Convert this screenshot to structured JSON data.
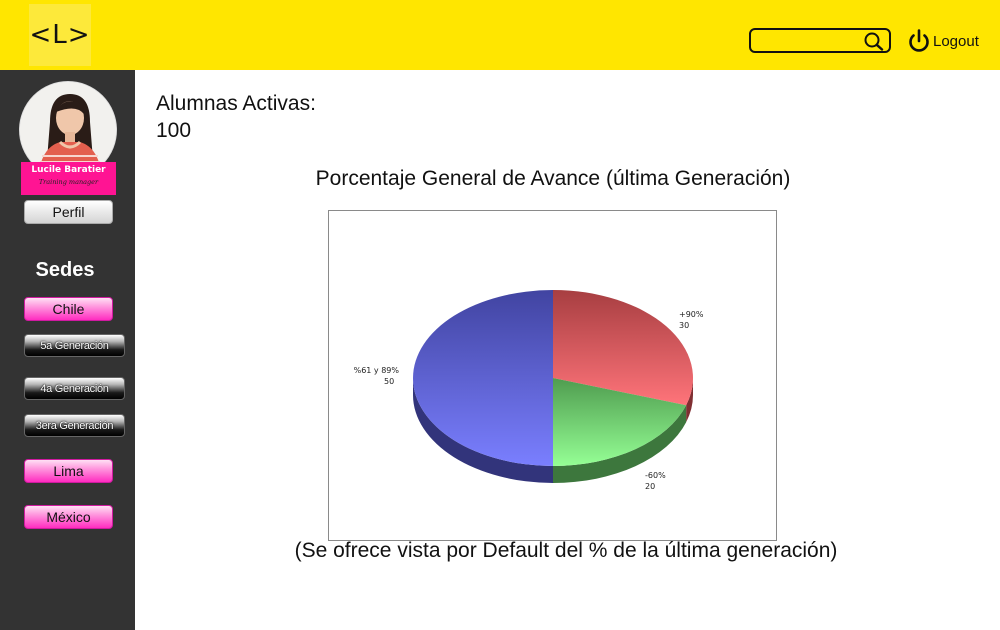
{
  "header": {
    "logo_text": "<L>",
    "search": {
      "value": "",
      "placeholder": "",
      "icon": "search-icon"
    },
    "logout_label": "Logout",
    "logout_icon": "power-icon",
    "accent_color": "#ffe600"
  },
  "sidebar": {
    "profile": {
      "name": "Lucile Baratier",
      "role": "Training manager"
    },
    "perfil_label": "Perfil",
    "sedes_heading": "Sedes",
    "sedes": [
      {
        "label": "Chile",
        "generations": [
          "5a Generación",
          "4a Generación",
          "3era Generación"
        ]
      },
      {
        "label": "Lima"
      },
      {
        "label": "México"
      }
    ],
    "accent_color": "#ff1493",
    "background": "#333333"
  },
  "main": {
    "active_label": "Alumnas Activas:",
    "active_value": "100",
    "chart_title": "Porcentaje General de Avance (última Generación)",
    "footer_note": "(Se ofrece vista por Default del % de la última generación)"
  },
  "chart_data": {
    "type": "pie",
    "title": "",
    "slices": [
      {
        "label": "+90%",
        "value": 30,
        "color": "#e8565a"
      },
      {
        "label": "-60%",
        "value": 20,
        "color": "#6ed86e"
      },
      {
        "label": "%61 y 89%",
        "value": 50,
        "color": "#5a5ee0"
      }
    ],
    "style": "3d"
  }
}
